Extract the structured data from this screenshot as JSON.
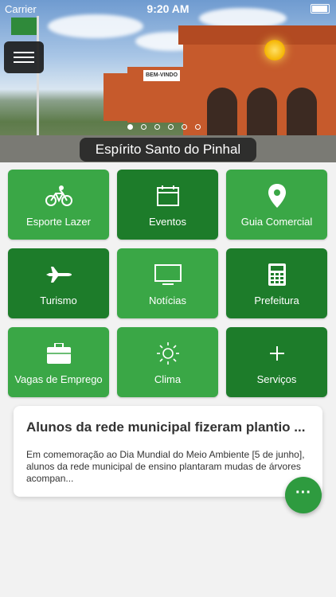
{
  "status_bar": {
    "carrier": "Carrier",
    "time": "9:20 AM"
  },
  "hero": {
    "city_name": "Espírito Santo do Pinhal",
    "sign_text": "BEM-VINDO",
    "carousel": {
      "count": 6,
      "active_index": 0
    }
  },
  "tiles": [
    {
      "label": "Esporte Lazer",
      "icon": "bicycle-icon",
      "style": "light"
    },
    {
      "label": "Eventos",
      "icon": "calendar-icon",
      "style": "dark"
    },
    {
      "label": "Guia Comercial",
      "icon": "map-pin-icon",
      "style": "light"
    },
    {
      "label": "Turismo",
      "icon": "airplane-icon",
      "style": "dark"
    },
    {
      "label": "Notícias",
      "icon": "tv-icon",
      "style": "light"
    },
    {
      "label": "Prefeitura",
      "icon": "calculator-icon",
      "style": "dark"
    },
    {
      "label": "Vagas de Emprego",
      "icon": "briefcase-icon",
      "style": "light"
    },
    {
      "label": "Clima",
      "icon": "sun-icon",
      "style": "light"
    },
    {
      "label": "Serviços",
      "icon": "plus-icon",
      "style": "dark"
    }
  ],
  "news": {
    "title": "Alunos da rede municipal fizeram plantio ...",
    "body": "Em comemoração ao Dia Mundial do Meio Ambiente [5 de junho], alunos da rede municipal de ensino plantaram mudas de árvores acompan..."
  },
  "fab": {
    "label": "···"
  },
  "colors": {
    "tile_light": "#3aa746",
    "tile_dark": "#1d7c2a"
  }
}
